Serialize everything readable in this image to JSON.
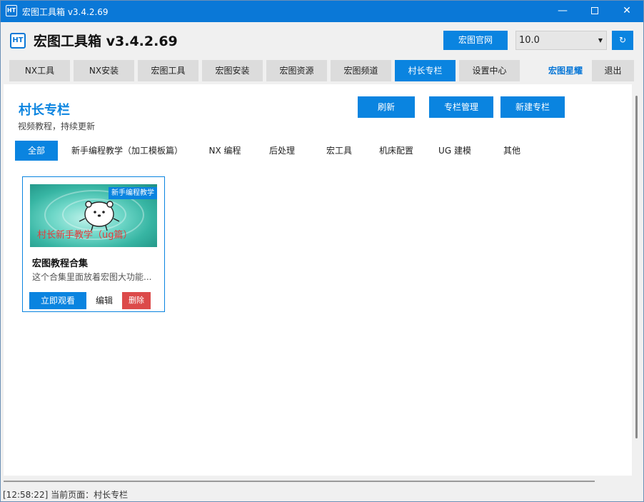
{
  "window": {
    "title": "宏图工具箱 v3.4.2.69",
    "minimize": "—",
    "close": "✕"
  },
  "header": {
    "logo": "HT",
    "app_title": "宏图工具箱 v3.4.2.69",
    "site_button": "宏图官网",
    "version_value": "10.0",
    "refresh_symbol": "↻"
  },
  "tabs": [
    {
      "label": "NX工具"
    },
    {
      "label": "NX安装"
    },
    {
      "label": "宏图工具"
    },
    {
      "label": "宏图安装"
    },
    {
      "label": "宏图资源"
    },
    {
      "label": "宏图频道"
    },
    {
      "label": "村长专栏",
      "active": true
    },
    {
      "label": "设置中心"
    }
  ],
  "tab_link": "宏图星耀",
  "logout": "退出",
  "section": {
    "title": "村长专栏",
    "subtitle": "视频教程，持续更新",
    "actions": [
      "刷新",
      "专栏管理",
      "新建专栏"
    ]
  },
  "categories": [
    "全部",
    "新手编程教学（加工模板篇）",
    "NX 编程",
    "后处理",
    "宏工具",
    "机床配置",
    "UG 建模",
    "其他"
  ],
  "card": {
    "tag": "新手编程教学",
    "thumb_text": "村长新手教学（ug篇）",
    "title": "宏图教程合集",
    "description": "这个合集里面放着宏图大功能...",
    "watch": "立即观看",
    "edit": "编辑",
    "delete": "删除"
  },
  "status": {
    "text": "[12:58:22] 当前页面：村长专栏"
  },
  "colors": {
    "accent": "#0a84e0",
    "titlebar": "#0a78d7",
    "danger": "#dc4a4a"
  }
}
